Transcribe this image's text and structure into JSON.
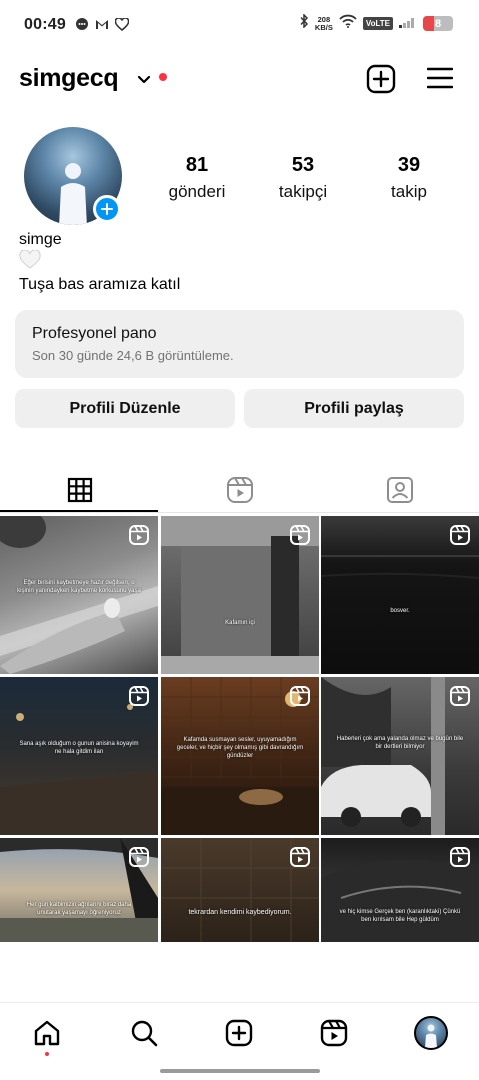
{
  "status_bar": {
    "time": "00:49",
    "net_speed_value": "208",
    "net_speed_unit": "KB/S",
    "volte": "VoLTE",
    "battery_level": "8",
    "battery_color": "#e8474a"
  },
  "header": {
    "username": "simgecq",
    "icons": [
      "chevron-down-icon",
      "notification-dot",
      "plus-square-icon",
      "menu-icon"
    ]
  },
  "profile": {
    "stats": [
      {
        "value": "81",
        "label": "gönderi"
      },
      {
        "value": "53",
        "label": "takipçi"
      },
      {
        "value": "39",
        "label": "takip"
      }
    ],
    "name": "simge",
    "heart": "🤍",
    "bio": "Tuşa bas aramıza katıl"
  },
  "dashboard": {
    "title": "Profesyonel pano",
    "subtitle": "Son 30 günde 24,6 B görüntüleme."
  },
  "buttons": {
    "edit": "Profili Düzenle",
    "share": "Profili paylaş"
  },
  "tabs": [
    "grid-icon",
    "reels-icon",
    "tagged-icon"
  ],
  "grid": {
    "tiles": [
      {
        "caption": "Eğer birisini kaybetmeye hazır değilsen, o kişinin yanındayken kaybetme korkusunu yaşa",
        "scene": "tile-street"
      },
      {
        "caption": "Kafamın içi",
        "scene": "tile-door"
      },
      {
        "caption": "bosver.",
        "scene": "tile-sea"
      },
      {
        "caption": "Sana aşık olduğum o gunun anisina koyayim ne hala gitdim ilan",
        "scene": "tile-night-road"
      },
      {
        "caption": "Kafamda susmayan sesler, uyuyamadığım geceler, ve hiçbir şey olmamış gibi davrandığım gündüzler",
        "scene": "tile-kitchen"
      },
      {
        "caption": "Haberleri çok ama yalanda olmaz ve bugün bile bir dertleri bilmiyor",
        "scene": "tile-car"
      },
      {
        "caption": "Her gün kalbimizin ağrılarını biraz daha unutarak yaşamayı öğreniyoruz",
        "scene": "tile-sunset"
      },
      {
        "caption": "tekrardan kendimi kaybediyorum.",
        "scene": "tile-floor"
      },
      {
        "caption": "ve hiç kimse Gerçek ben (karanlıktaki) Çünkü ben kırılsam bile Hep güldüm",
        "scene": "tile-car-interior"
      }
    ]
  },
  "bottom_nav": [
    "home-icon",
    "search-icon",
    "create-icon",
    "reels-icon",
    "profile-avatar"
  ],
  "colors": {
    "accent_blue": "#0095f6",
    "notification_red": "#ff3040",
    "card_bg": "#efefef"
  }
}
